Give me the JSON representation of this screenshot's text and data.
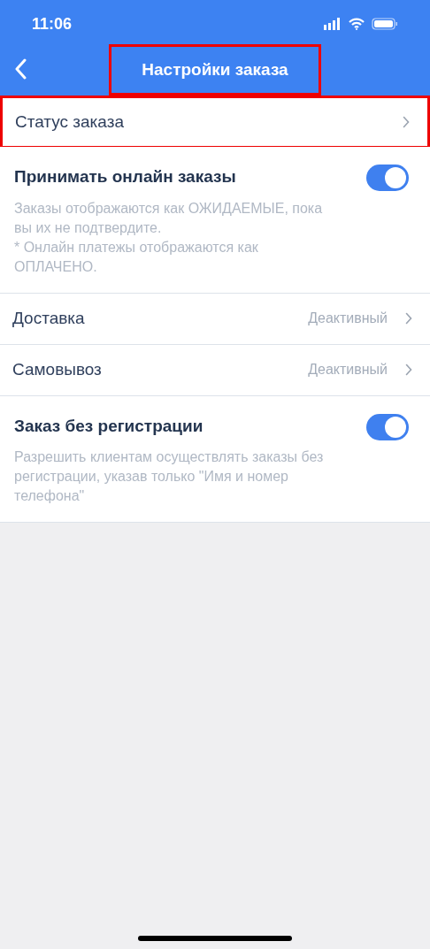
{
  "status_bar": {
    "time": "11:06"
  },
  "nav": {
    "title": "Настройки заказа",
    "highlighted": true
  },
  "rows": [
    {
      "kind": "link",
      "label": "Статус заказа",
      "highlighted": true
    },
    {
      "kind": "toggle",
      "label": "Принимать онлайн заказы",
      "on": true,
      "description": "Заказы отображаются как ОЖИДАЕМЫЕ, пока вы их не подтвердите.\n* Онлайн платежы отображаются как ОПЛАЧЕНО."
    },
    {
      "kind": "link",
      "label": "Доставка",
      "value": "Деактивный",
      "highlighted": false
    },
    {
      "kind": "link",
      "label": "Самовывоз",
      "value": "Деактивный",
      "highlighted": false
    },
    {
      "kind": "toggle",
      "label": "Заказ без регистрации",
      "on": true,
      "description": "Разрешить клиентам осуществлять заказы без регистрации, указав только \"Имя и номер телефона\""
    }
  ]
}
